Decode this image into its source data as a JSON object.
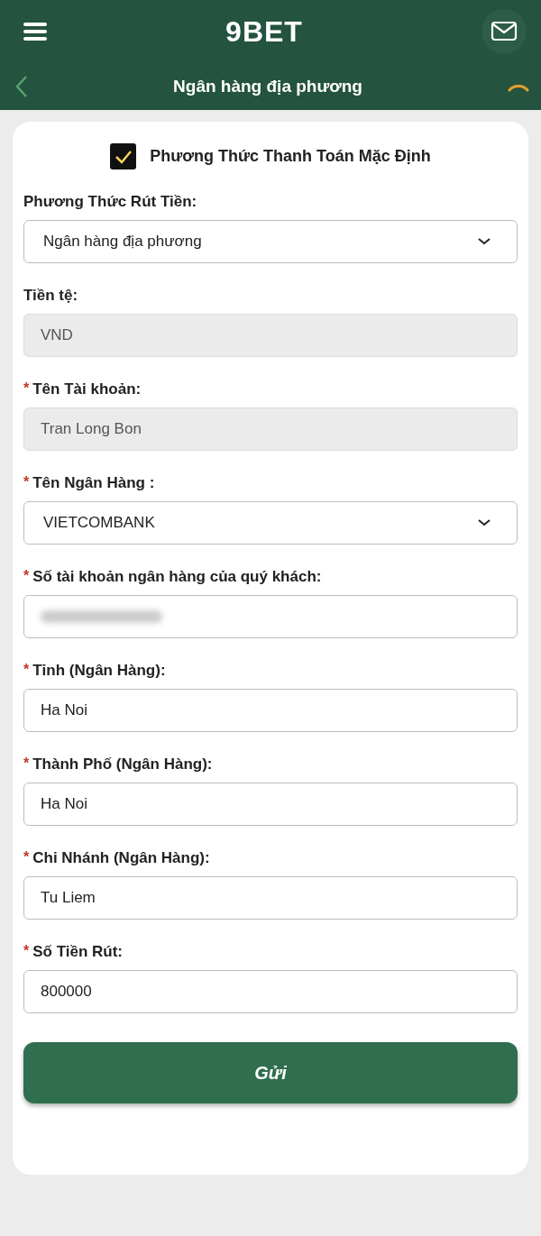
{
  "header": {
    "logo": "9BET"
  },
  "subheader": {
    "title": "Ngân hàng địa phương"
  },
  "default_method": {
    "label": "Phương Thức Thanh Toán Mặc Định",
    "checked": true
  },
  "fields": [
    {
      "label": "Phương Thức Rút Tiền:",
      "kind": "select",
      "value": "Ngân hàng địa phương"
    },
    {
      "label": "Tiền tệ:",
      "kind": "readonly",
      "value": "VND"
    },
    {
      "marker": "*",
      "label": "Tên Tài khoản:",
      "kind": "readonly",
      "value": "Tran Long Bon"
    },
    {
      "marker": "*",
      "label": "Tên Ngân Hàng :",
      "kind": "select",
      "value": "VIETCOMBANK"
    },
    {
      "marker": "*",
      "label": "Số tài khoản ngân hàng của quý khách:",
      "kind": "masked"
    },
    {
      "marker": "*",
      "label": "Tỉnh (Ngân Hàng):",
      "kind": "input",
      "value": "Ha Noi"
    },
    {
      "marker": "*",
      "label": "Thành Phố (Ngân Hàng):",
      "kind": "input",
      "value": "Ha Noi"
    },
    {
      "marker": "*",
      "label": "Chi Nhánh (Ngân Hàng):",
      "kind": "input",
      "value": "Tu Liem"
    },
    {
      "marker": "*",
      "label": "Số Tiền Rút:",
      "kind": "input",
      "value": "800000"
    }
  ],
  "submit": "Gửi"
}
